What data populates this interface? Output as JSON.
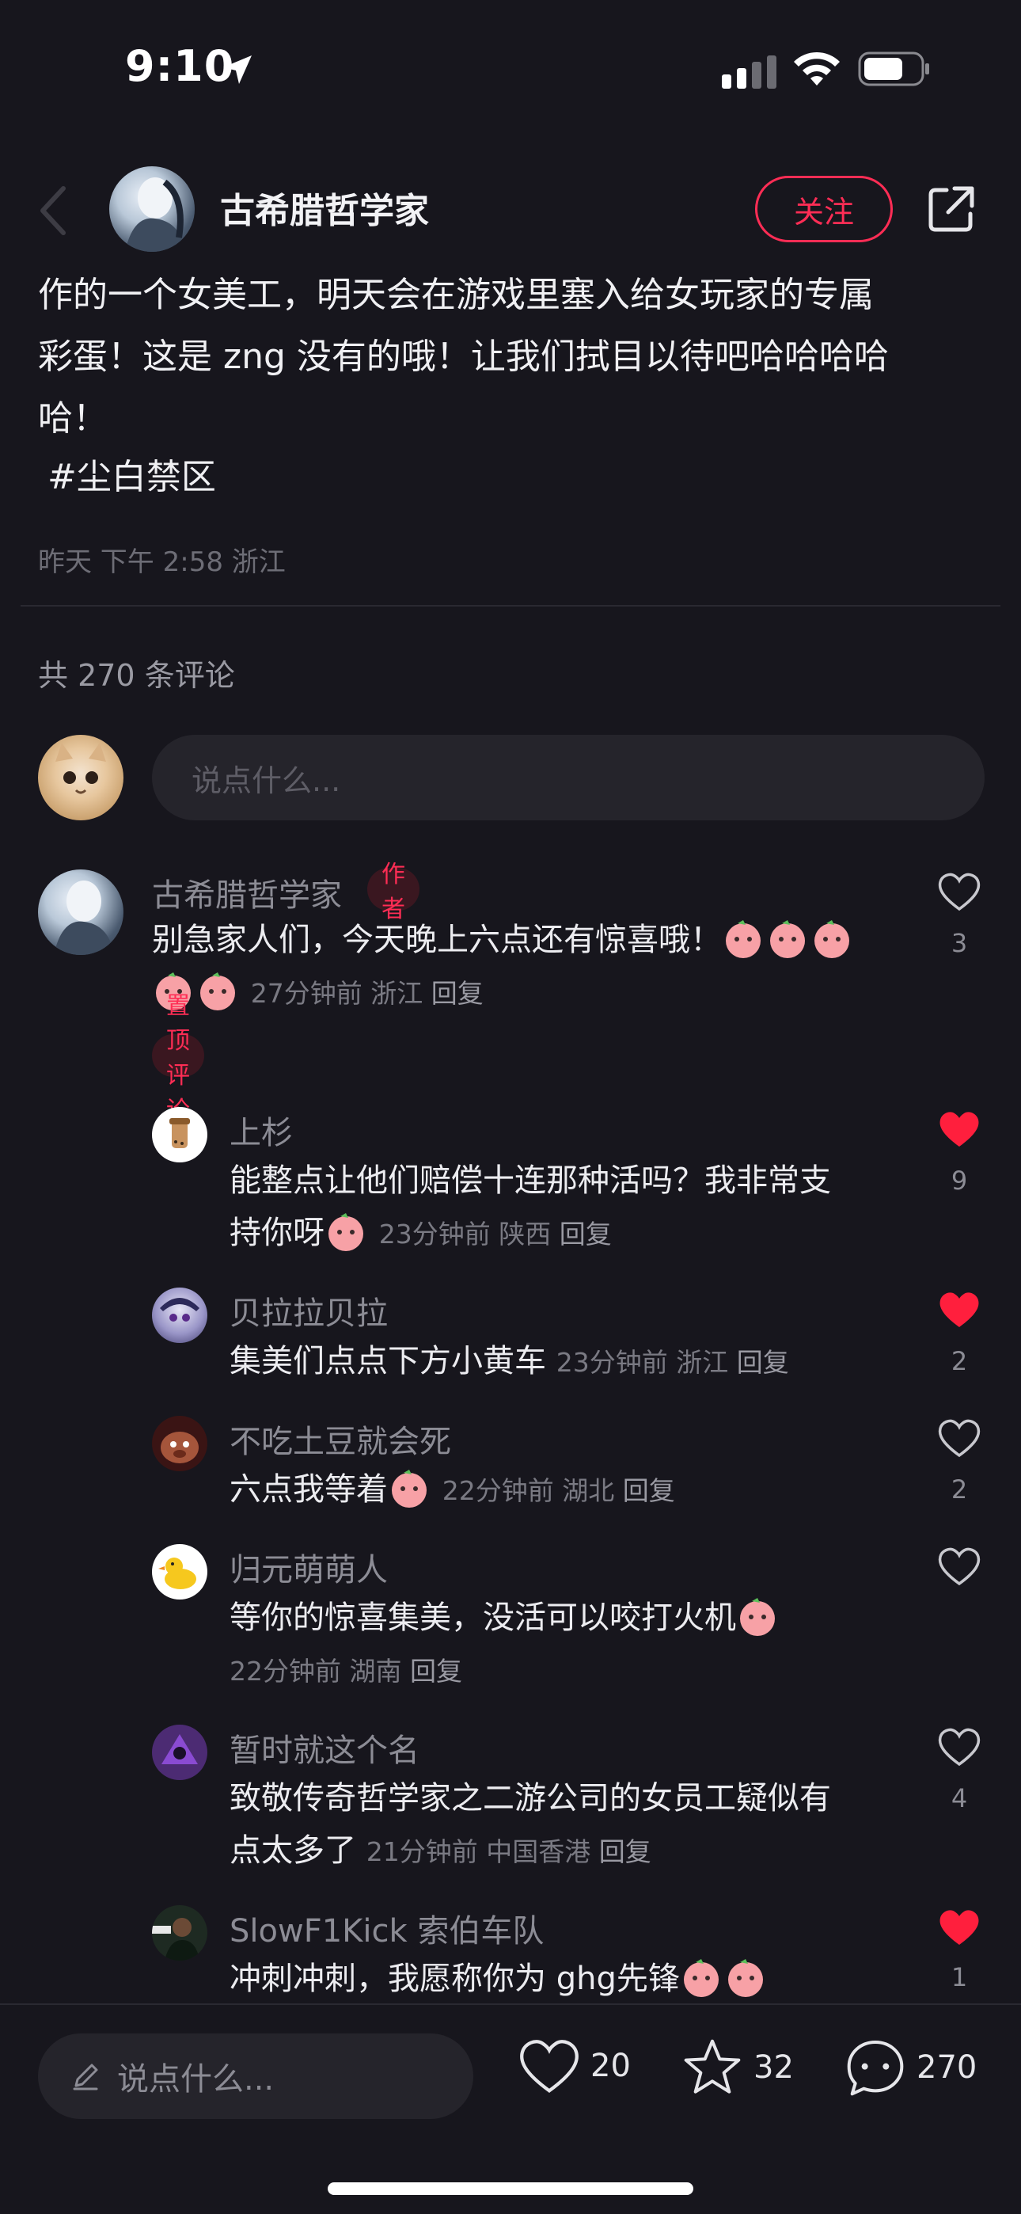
{
  "status": {
    "time": "9:10"
  },
  "header": {
    "author_name": "古希腊哲学家",
    "follow_label": "关注"
  },
  "post": {
    "line1": "作的一个女美工，明天会在游戏里塞入给女玩家的专属",
    "line2": "彩蛋！这是 zng 没有的哦！让我们拭目以待吧哈哈哈哈",
    "line3": "哈！",
    "hashtag": "#尘白禁区",
    "meta": "昨天 下午 2:58 浙江"
  },
  "comments_header": {
    "count_label": "共 270 条评论",
    "input_placeholder": "说点什么..."
  },
  "comments": [
    {
      "name": "古希腊哲学家",
      "tag": "作者",
      "text": "别急家人们，今天晚上六点还有惊喜哦！",
      "time": "27分钟前",
      "location": "浙江",
      "reply": "回复",
      "likes": "3",
      "liked": false,
      "pinned_label": "置顶评论"
    },
    {
      "name": "上杉",
      "text1": "能整点让他们赔偿十连那种活吗？我非常支",
      "text2": "持你呀",
      "time": "23分钟前",
      "location": "陕西",
      "reply": "回复",
      "likes": "9",
      "liked": true
    },
    {
      "name": "贝拉拉贝拉",
      "text": "集美们点点下方小黄车",
      "time": "23分钟前",
      "location": "浙江",
      "reply": "回复",
      "likes": "2",
      "liked": true
    },
    {
      "name": "不吃土豆就会死",
      "text": "六点我等着",
      "time": "22分钟前",
      "location": "湖北",
      "reply": "回复",
      "likes": "2",
      "liked": false
    },
    {
      "name": "归元萌萌人",
      "text": "等你的惊喜集美，没活可以咬打火机",
      "time": "22分钟前",
      "location": "湖南",
      "reply": "回复",
      "likes": "",
      "liked": false
    },
    {
      "name": "暂时就这个名",
      "text1": "致敬传奇哲学家之二游公司的女员工疑似有",
      "text2": "点太多了",
      "time": "21分钟前",
      "location": "中国香港",
      "reply": "回复",
      "likes": "4",
      "liked": false
    },
    {
      "name": "SlowF1Kick 索伯车队",
      "text": "冲刺冲刺，我愿称你为 ghg先锋",
      "likes": "1",
      "liked": true
    }
  ],
  "bottom_bar": {
    "input_placeholder": "说点什么...",
    "likes": "20",
    "favorites": "32",
    "comments": "270"
  },
  "colors": {
    "background": "#17161d",
    "accent": "#ff2d55",
    "liked": "#ff1f3d"
  }
}
